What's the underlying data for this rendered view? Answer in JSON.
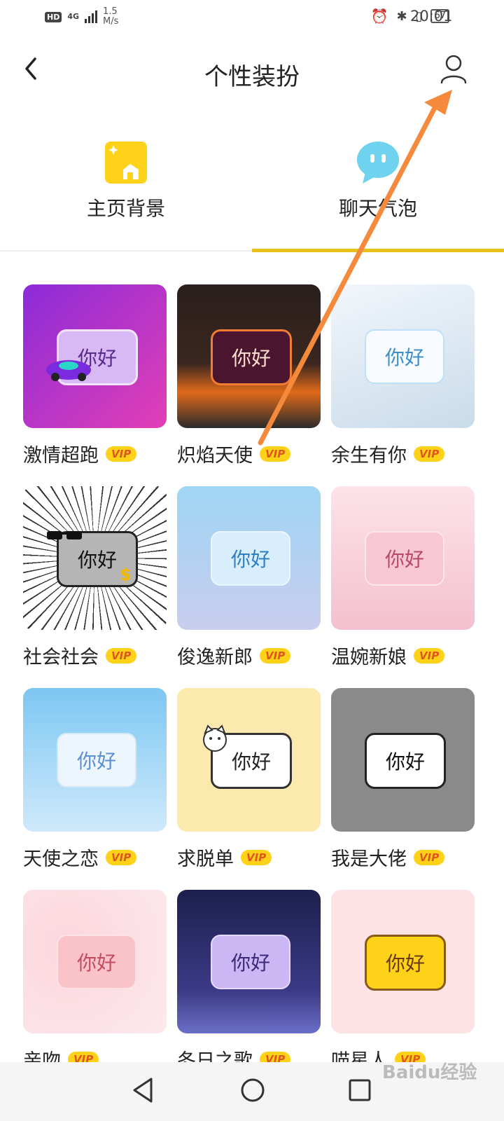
{
  "status_bar": {
    "hd": "HD",
    "network": "4G",
    "speed_value": "1.5",
    "speed_unit": "M/s",
    "battery": "67",
    "time": "20:01"
  },
  "header": {
    "title": "个性装扮"
  },
  "tabs": [
    {
      "label": "主页背景",
      "icon": "home-card-icon",
      "color": "#ffd21a",
      "selected": false
    },
    {
      "label": "聊天气泡",
      "icon": "chat-bubble-icon",
      "color": "#6fd3ef",
      "selected": true
    }
  ],
  "bubble_text": "你好",
  "vip_label": "VIP",
  "items": [
    {
      "name": "激情超跑",
      "vip": true
    },
    {
      "name": "炽焰天使",
      "vip": true
    },
    {
      "name": "余生有你",
      "vip": true
    },
    {
      "name": "社会社会",
      "vip": true
    },
    {
      "name": "俊逸新郎",
      "vip": true
    },
    {
      "name": "温婉新娘",
      "vip": true
    },
    {
      "name": "天使之恋",
      "vip": true
    },
    {
      "name": "求脱单",
      "vip": true
    },
    {
      "name": "我是大佬",
      "vip": true
    },
    {
      "name": "亲吻",
      "vip": true
    },
    {
      "name": "冬日之歌",
      "vip": true
    },
    {
      "name": "喵星人",
      "vip": true
    }
  ],
  "watermark": "Baidu经验",
  "accent_color": "#e8c21b",
  "annotation_arrow_color": "#f58a3c"
}
